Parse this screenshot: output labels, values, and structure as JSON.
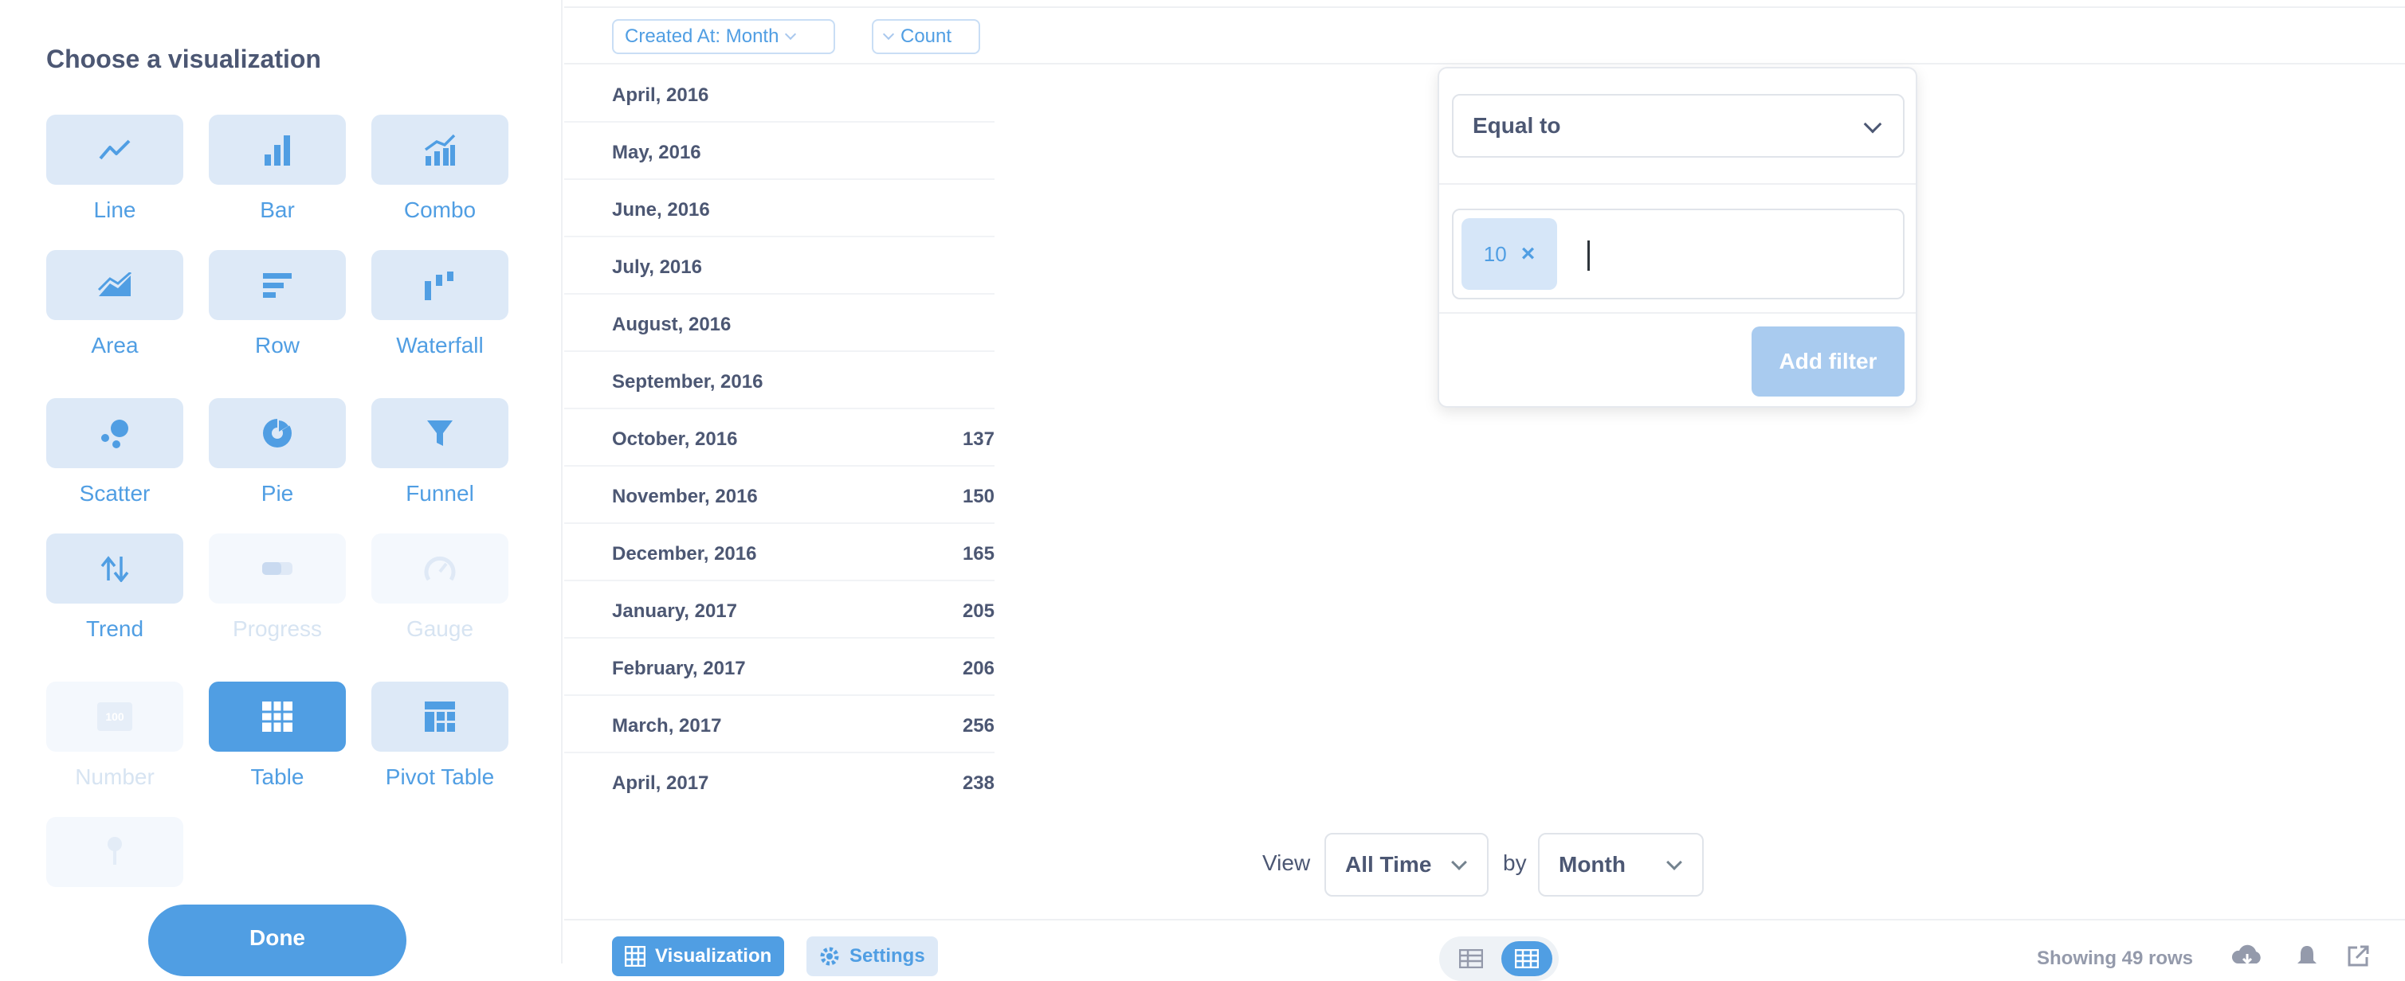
{
  "sidebar": {
    "title": "Choose a visualization",
    "tiles": [
      {
        "label": "Line",
        "icon": "line-chart-icon"
      },
      {
        "label": "Bar",
        "icon": "bar-chart-icon"
      },
      {
        "label": "Combo",
        "icon": "combo-chart-icon"
      },
      {
        "label": "Area",
        "icon": "area-chart-icon"
      },
      {
        "label": "Row",
        "icon": "row-chart-icon"
      },
      {
        "label": "Waterfall",
        "icon": "waterfall-chart-icon"
      },
      {
        "label": "Scatter",
        "icon": "scatter-chart-icon"
      },
      {
        "label": "Pie",
        "icon": "pie-chart-icon"
      },
      {
        "label": "Funnel",
        "icon": "funnel-icon"
      },
      {
        "label": "Trend",
        "icon": "trend-icon"
      },
      {
        "label": "Progress",
        "icon": "progress-icon",
        "disabled": true
      },
      {
        "label": "Gauge",
        "icon": "gauge-icon",
        "disabled": true
      },
      {
        "label": "Number",
        "icon": "number-icon",
        "icon_text": "100",
        "disabled": true
      },
      {
        "label": "Table",
        "icon": "table-icon",
        "active": true
      },
      {
        "label": "Pivot Table",
        "icon": "pivot-table-icon"
      },
      {
        "label": "",
        "icon": "map-pin-icon",
        "disabled": true
      }
    ],
    "done_label": "Done"
  },
  "header": {
    "column_1": "Created At: Month",
    "column_2": "Count"
  },
  "table": {
    "rows": [
      {
        "date": "April, 2016",
        "count": ""
      },
      {
        "date": "May, 2016",
        "count": ""
      },
      {
        "date": "June, 2016",
        "count": ""
      },
      {
        "date": "July, 2016",
        "count": ""
      },
      {
        "date": "August, 2016",
        "count": ""
      },
      {
        "date": "September, 2016",
        "count": ""
      },
      {
        "date": "October, 2016",
        "count": "137"
      },
      {
        "date": "November, 2016",
        "count": "150"
      },
      {
        "date": "December, 2016",
        "count": "165"
      },
      {
        "date": "January, 2017",
        "count": "205"
      },
      {
        "date": "February, 2017",
        "count": "206"
      },
      {
        "date": "March, 2017",
        "count": "256"
      },
      {
        "date": "April, 2017",
        "count": "238"
      }
    ]
  },
  "filter_popover": {
    "operator": "Equal to",
    "value_token": "10",
    "remove_glyph": "×",
    "add_filter_label": "Add filter"
  },
  "view_bar": {
    "view_label": "View",
    "range_value": "All Time",
    "by_label": "by",
    "unit_value": "Month"
  },
  "footer": {
    "visualization_label": "Visualization",
    "settings_label": "Settings",
    "rows_label": "Showing 49 rows"
  },
  "colors": {
    "brand": "#509ee3",
    "tile_bg": "#dde9f7",
    "text": "#4c5773"
  }
}
